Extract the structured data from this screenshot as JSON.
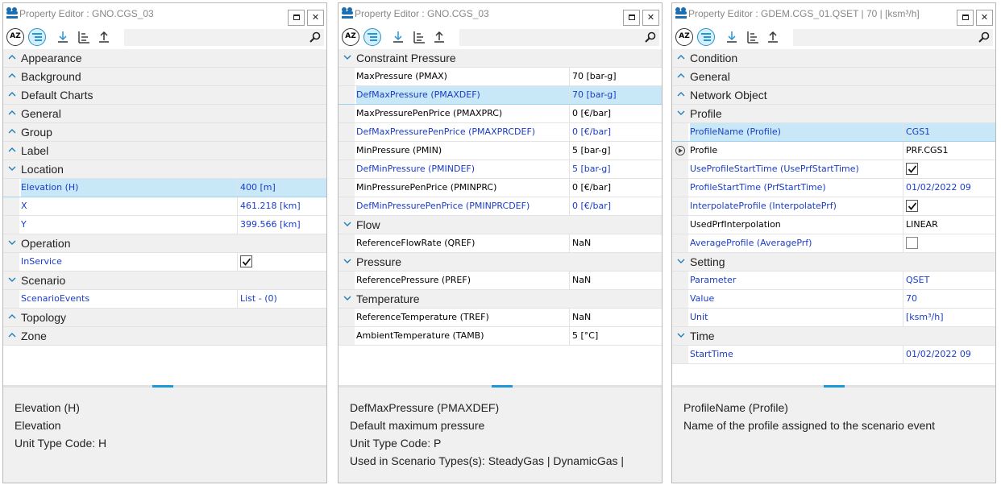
{
  "panels": [
    {
      "title": "Property Editor : GNO.CGS_03",
      "name_col": 290,
      "rows": [
        {
          "kind": "cat",
          "label": "Appearance",
          "expanded": false
        },
        {
          "kind": "cat",
          "label": "Background",
          "expanded": false
        },
        {
          "kind": "cat",
          "label": "Default Charts",
          "expanded": false
        },
        {
          "kind": "cat",
          "label": "General",
          "expanded": false
        },
        {
          "kind": "cat",
          "label": "Group",
          "expanded": false
        },
        {
          "kind": "cat",
          "label": "Label",
          "expanded": false
        },
        {
          "kind": "cat",
          "label": "Location",
          "expanded": true
        },
        {
          "kind": "prop",
          "name": "Elevation (H)",
          "value": "400 [m]",
          "blue": true,
          "selected": true
        },
        {
          "kind": "prop",
          "name": "X",
          "value": "461.218 [km]",
          "blue": true
        },
        {
          "kind": "prop",
          "name": "Y",
          "value": "399.566 [km]",
          "blue": true
        },
        {
          "kind": "cat",
          "label": "Operation",
          "expanded": true
        },
        {
          "kind": "prop",
          "name": "InService",
          "value": "",
          "blue": true,
          "check": "checked"
        },
        {
          "kind": "cat",
          "label": "Scenario",
          "expanded": true
        },
        {
          "kind": "prop",
          "name": "ScenarioEvents",
          "value": "List - (0)",
          "blue": true
        },
        {
          "kind": "cat",
          "label": "Topology",
          "expanded": false
        },
        {
          "kind": "cat",
          "label": "Zone",
          "expanded": false
        }
      ],
      "description": [
        "Elevation (H)",
        "Elevation",
        "Unit Type Code: H"
      ]
    },
    {
      "title": "Property Editor : GNO.CGS_03",
      "name_col": 286,
      "rows": [
        {
          "kind": "cat",
          "label": "Constraint Pressure",
          "expanded": true
        },
        {
          "kind": "prop",
          "name": "MaxPressure (PMAX)",
          "value": "70 [bar-g]",
          "blue": false
        },
        {
          "kind": "prop",
          "name": "DefMaxPressure (PMAXDEF)",
          "value": "70 [bar-g]",
          "blue": true,
          "selected": true
        },
        {
          "kind": "prop",
          "name": "MaxPressurePenPrice (PMAXPRC)",
          "value": "0 [€/bar]",
          "blue": false
        },
        {
          "kind": "prop",
          "name": "DefMaxPressurePenPrice (PMAXPRCDEF)",
          "value": "0 [€/bar]",
          "blue": true
        },
        {
          "kind": "prop",
          "name": "MinPressure (PMIN)",
          "value": "5 [bar-g]",
          "blue": false
        },
        {
          "kind": "prop",
          "name": "DefMinPressure (PMINDEF)",
          "value": "5 [bar-g]",
          "blue": true
        },
        {
          "kind": "prop",
          "name": "MinPressurePenPrice (PMINPRC)",
          "value": "0 [€/bar]",
          "blue": false
        },
        {
          "kind": "prop",
          "name": "DefMinPressurePenPrice (PMINPRCDEF)",
          "value": "0 [€/bar]",
          "blue": true
        },
        {
          "kind": "cat",
          "label": "Flow",
          "expanded": true
        },
        {
          "kind": "prop",
          "name": "ReferenceFlowRate (QREF)",
          "value": "NaN",
          "blue": false
        },
        {
          "kind": "cat",
          "label": "Pressure",
          "expanded": true
        },
        {
          "kind": "prop",
          "name": "ReferencePressure (PREF)",
          "value": "NaN",
          "blue": false
        },
        {
          "kind": "cat",
          "label": "Temperature",
          "expanded": true
        },
        {
          "kind": "prop",
          "name": "ReferenceTemperature (TREF)",
          "value": "NaN",
          "blue": false
        },
        {
          "kind": "prop",
          "name": "AmbientTemperature (TAMB)",
          "value": "5 [°C]",
          "blue": false
        }
      ],
      "description": [
        "DefMaxPressure (PMAXDEF)",
        "Default maximum pressure",
        "Unit Type Code: P",
        "Used in Scenario Types(s): SteadyGas | DynamicGas |"
      ]
    },
    {
      "title": "Property Editor : GDEM.CGS_01.QSET | 70 | [ksm³/h]",
      "name_col": 286,
      "rows": [
        {
          "kind": "cat",
          "label": "Condition",
          "expanded": false
        },
        {
          "kind": "cat",
          "label": "General",
          "expanded": false
        },
        {
          "kind": "cat",
          "label": "Network Object",
          "expanded": false
        },
        {
          "kind": "cat",
          "label": "Profile",
          "expanded": true
        },
        {
          "kind": "prop",
          "name": "ProfileName (Profile)",
          "value": "CGS1",
          "blue": true,
          "selected": true
        },
        {
          "kind": "prop",
          "name": "Profile",
          "value": "PRF.CGS1",
          "blue": false,
          "expander": true
        },
        {
          "kind": "prop",
          "name": "UseProfileStartTime (UsePrfStartTime)",
          "value": "",
          "blue": true,
          "check": "checked"
        },
        {
          "kind": "prop",
          "name": "ProfileStartTime (PrfStartTime)",
          "value": "01/02/2022 09",
          "blue": true
        },
        {
          "kind": "prop",
          "name": "InterpolateProfile (InterpolatePrf)",
          "value": "",
          "blue": true,
          "check": "checked"
        },
        {
          "kind": "prop",
          "name": "UsedPrfInterpolation",
          "value": "LINEAR",
          "blue": false
        },
        {
          "kind": "prop",
          "name": "AverageProfile (AveragePrf)",
          "value": "",
          "blue": true,
          "check": "empty"
        },
        {
          "kind": "cat",
          "label": "Setting",
          "expanded": true
        },
        {
          "kind": "prop",
          "name": "Parameter",
          "value": "QSET",
          "blue": true
        },
        {
          "kind": "prop",
          "name": "Value",
          "value": "70",
          "blue": true
        },
        {
          "kind": "prop",
          "name": "Unit",
          "value": "[ksm³/h]",
          "blue": true
        },
        {
          "kind": "cat",
          "label": "Time",
          "expanded": true
        },
        {
          "kind": "prop",
          "name": "StartTime",
          "value": "01/02/2022 09",
          "blue": true
        }
      ],
      "description": [
        "ProfileName (Profile)",
        "Name of the profile assigned to the scenario event"
      ]
    }
  ],
  "colors": {
    "accent": "#1e97d6",
    "selection": "#c9e8f7",
    "blue_text": "#1a3cc8"
  },
  "icons": [
    "app-logo-icon",
    "restore-icon",
    "close-icon",
    "sort-alphabetical-icon",
    "categorized-icon",
    "import-icon",
    "tree-icon",
    "export-icon",
    "search-icon",
    "chevron-up-icon",
    "chevron-down-icon",
    "expand-arrow-icon",
    "checkbox-icon"
  ]
}
